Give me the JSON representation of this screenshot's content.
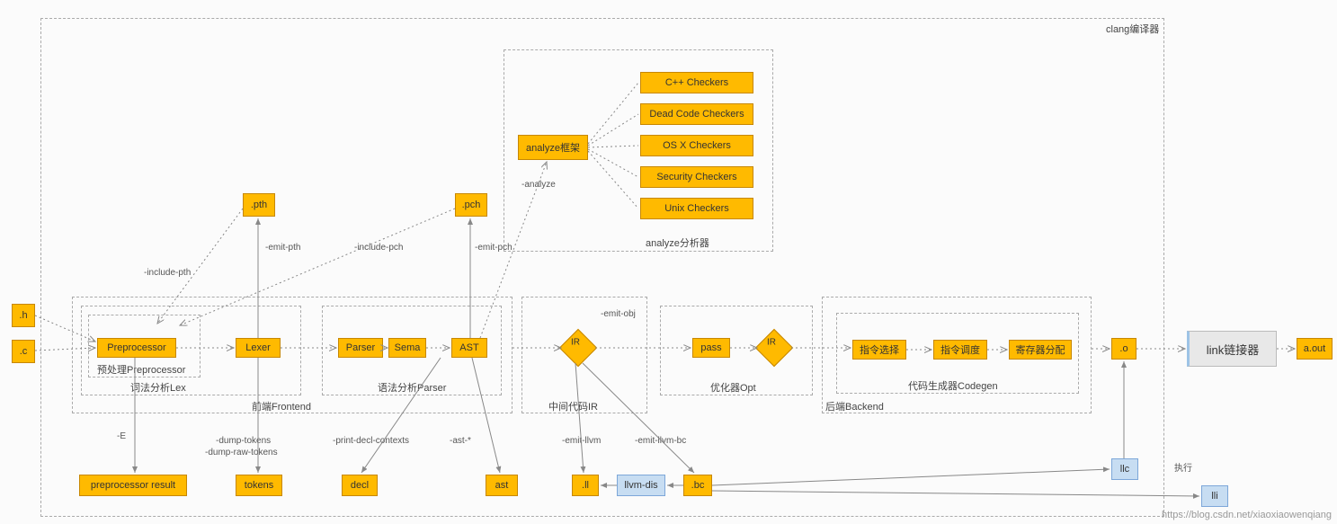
{
  "title": "clang编译器",
  "inputs": {
    "h": ".h",
    "c": ".c"
  },
  "frontend": {
    "label": "前端Frontend",
    "preproc_group": "预处理Preprocessor",
    "lex_group": "词法分析Lex",
    "parse_group": "语法分析Parser",
    "preprocessor": "Preprocessor",
    "lexer": "Lexer",
    "parser": "Parser",
    "sema": "Sema",
    "ast": "AST"
  },
  "pth": ".pth",
  "pch": ".pch",
  "analyze": {
    "group": "analyze分析器",
    "box": "analyze框架",
    "checkers": [
      "C++ Checkers",
      "Dead Code Checkers",
      "OS X Checkers",
      "Security Checkers",
      "Unix Checkers"
    ]
  },
  "midir": {
    "group": "中间代码IR",
    "ir": "IR"
  },
  "opt": {
    "group": "优化器Opt",
    "pass": "pass",
    "ir": "IR"
  },
  "backend": {
    "group": "后端Backend",
    "codegen_group": "代码生成器Codegen",
    "isel": "指令选择",
    "isched": "指令调度",
    "regalloc": "寄存器分配"
  },
  "o": ".o",
  "linker": "link链接器",
  "aout": "a.out",
  "outputs": {
    "preproc_result": "preprocessor result",
    "tokens": "tokens",
    "decl": "decl",
    "ast": "ast",
    "ll": ".ll",
    "llvmdis": "llvm-dis",
    "bc": ".bc",
    "llc": "llc",
    "lli": "lli"
  },
  "labels": {
    "include_pth": "-include-pth",
    "emit_pth": "-emit-pth",
    "include_pch": "-include-pch",
    "emit_pch": "-emit-pch",
    "analyze": "-analyze",
    "emit_obj": "-emit-obj",
    "E": "-E",
    "dump_tokens": "-dump-tokens",
    "dump_raw_tokens": "-dump-raw-tokens",
    "print_decl": "-print-decl-contexts",
    "ast_star": "-ast-*",
    "emit_llvm": "-emit-llvm",
    "emit_llvm_bc": "-emit-llvm-bc",
    "exec": "执行"
  }
}
